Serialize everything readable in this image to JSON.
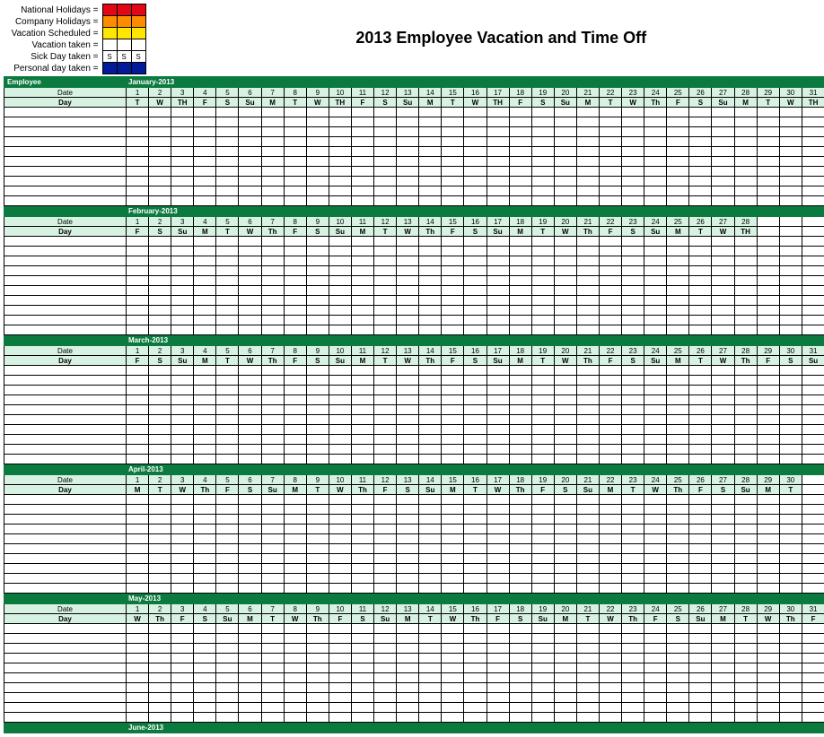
{
  "title": "2013 Employee Vacation and Time Off",
  "legend": [
    {
      "label": "National Holidays =",
      "swatches": [
        "#e30613",
        "#e30613",
        "#e30613"
      ]
    },
    {
      "label": "Company Holidays =",
      "swatches": [
        "#ff8c00",
        "#ff8c00",
        "#ff8c00"
      ]
    },
    {
      "label": "Vacation Scheduled =",
      "swatches": [
        "#ffe600",
        "#ffe600",
        "#ffe600"
      ]
    },
    {
      "label": "Vacation taken =",
      "swatches": [
        "#ffffff",
        "#ffffff",
        "#ffffff"
      ]
    },
    {
      "label": "Sick Day taken =",
      "swatches": [
        "#ffffff",
        "#ffffff",
        "#ffffff"
      ],
      "text": "S"
    },
    {
      "label": "Personal day taken =",
      "swatches": [
        "#001a9a",
        "#001a9a",
        "#001a9a"
      ]
    }
  ],
  "employee_header": "Employee",
  "date_label": "Date",
  "day_label": "Day",
  "body_rows_per_month": 10,
  "months": [
    {
      "name": "January-2013",
      "dates": [
        1,
        2,
        3,
        4,
        5,
        6,
        7,
        8,
        9,
        10,
        11,
        12,
        13,
        14,
        15,
        16,
        17,
        18,
        19,
        20,
        21,
        22,
        23,
        24,
        25,
        26,
        27,
        28,
        29,
        30,
        31
      ],
      "days": [
        "T",
        "W",
        "TH",
        "F",
        "S",
        "Su",
        "M",
        "T",
        "W",
        "TH",
        "F",
        "S",
        "Su",
        "M",
        "T",
        "W",
        "TH",
        "F",
        "S",
        "Su",
        "M",
        "T",
        "W",
        "Th",
        "F",
        "S",
        "Su",
        "M",
        "T",
        "W",
        "TH"
      ]
    },
    {
      "name": "February-2013",
      "dates": [
        1,
        2,
        3,
        4,
        5,
        6,
        7,
        8,
        9,
        10,
        11,
        12,
        13,
        14,
        15,
        16,
        17,
        18,
        19,
        20,
        21,
        22,
        23,
        24,
        25,
        26,
        27,
        28
      ],
      "days": [
        "F",
        "S",
        "Su",
        "M",
        "T",
        "W",
        "Th",
        "F",
        "S",
        "Su",
        "M",
        "T",
        "W",
        "Th",
        "F",
        "S",
        "Su",
        "M",
        "T",
        "W",
        "Th",
        "F",
        "S",
        "Su",
        "M",
        "T",
        "W",
        "TH"
      ]
    },
    {
      "name": "March-2013",
      "dates": [
        1,
        2,
        3,
        4,
        5,
        6,
        7,
        8,
        9,
        10,
        11,
        12,
        13,
        14,
        15,
        16,
        17,
        18,
        19,
        20,
        21,
        22,
        23,
        24,
        25,
        26,
        27,
        28,
        29,
        30,
        31
      ],
      "days": [
        "F",
        "S",
        "Su",
        "M",
        "T",
        "W",
        "Th",
        "F",
        "S",
        "Su",
        "M",
        "T",
        "W",
        "Th",
        "F",
        "S",
        "Su",
        "M",
        "T",
        "W",
        "Th",
        "F",
        "S",
        "Su",
        "M",
        "T",
        "W",
        "Th",
        "F",
        "S",
        "Su"
      ]
    },
    {
      "name": "April-2013",
      "dates": [
        1,
        2,
        3,
        4,
        5,
        6,
        7,
        8,
        9,
        10,
        11,
        12,
        13,
        14,
        15,
        16,
        17,
        18,
        19,
        20,
        21,
        22,
        23,
        24,
        25,
        26,
        27,
        28,
        29,
        30
      ],
      "days": [
        "M",
        "T",
        "W",
        "Th",
        "F",
        "S",
        "Su",
        "M",
        "T",
        "W",
        "Th",
        "F",
        "S",
        "Su",
        "M",
        "T",
        "W",
        "Th",
        "F",
        "S",
        "Su",
        "M",
        "T",
        "W",
        "Th",
        "F",
        "S",
        "Su",
        "M",
        "T"
      ]
    },
    {
      "name": "May-2013",
      "dates": [
        1,
        2,
        3,
        4,
        5,
        6,
        7,
        8,
        9,
        10,
        11,
        12,
        13,
        14,
        15,
        16,
        17,
        18,
        19,
        20,
        21,
        22,
        23,
        24,
        25,
        26,
        27,
        28,
        29,
        30,
        31
      ],
      "days": [
        "W",
        "Th",
        "F",
        "S",
        "Su",
        "M",
        "T",
        "W",
        "Th",
        "F",
        "S",
        "Su",
        "M",
        "T",
        "W",
        "Th",
        "F",
        "S",
        "Su",
        "M",
        "T",
        "W",
        "Th",
        "F",
        "S",
        "Su",
        "M",
        "T",
        "W",
        "Th",
        "F"
      ]
    },
    {
      "name": "June-2013",
      "dates": [],
      "days": []
    }
  ]
}
